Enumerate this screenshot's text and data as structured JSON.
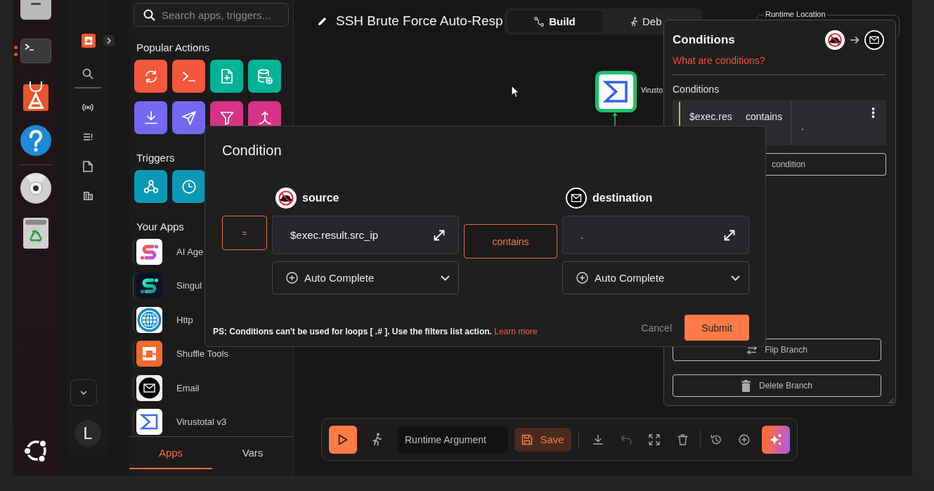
{
  "dock": {
    "apps": [
      {
        "kind": "files",
        "running": false
      },
      {
        "kind": "terminal",
        "running": true
      },
      {
        "kind": "store",
        "running": false
      },
      {
        "kind": "help",
        "running": false
      }
    ],
    "volumes": [
      {
        "kind": "disc"
      },
      {
        "kind": "trash"
      }
    ]
  },
  "nav_rail": {
    "items": [
      {
        "kind": "search",
        "selected": true
      },
      {
        "kind": "signal",
        "selected": false
      },
      {
        "kind": "list",
        "selected": false
      },
      {
        "kind": "file",
        "selected": false
      },
      {
        "kind": "table",
        "selected": false
      }
    ],
    "avatar": "L"
  },
  "sidebar": {
    "search": {
      "placeholder": "Search apps, triggers..."
    },
    "popular_title": "Popular Actions",
    "popular_actions": [
      {
        "kind": "repeat",
        "color": "#f4583c"
      },
      {
        "kind": "terminal",
        "color": "#f4583c"
      },
      {
        "kind": "file_add",
        "color": "#00b296"
      },
      {
        "kind": "database_add",
        "color": "#00b296"
      },
      {
        "kind": "download",
        "color": "#7468f0"
      },
      {
        "kind": "send",
        "color": "#7468f0"
      },
      {
        "kind": "filter",
        "color": "#d63384"
      },
      {
        "kind": "merge",
        "color": "#d63384"
      }
    ],
    "triggers_title": "Triggers",
    "triggers": [
      {
        "kind": "webhook",
        "color": "#0a98b4"
      },
      {
        "kind": "schedule",
        "color": "#0a98b4"
      }
    ],
    "apps_title": "Your Apps",
    "apps": [
      {
        "kind": "ai_agent",
        "name": "AI Age"
      },
      {
        "kind": "singul",
        "name": "Singul"
      },
      {
        "kind": "http",
        "name": "Http"
      },
      {
        "kind": "shuffle_tools",
        "name": "Shuffle Tools"
      },
      {
        "kind": "email",
        "name": "Email"
      },
      {
        "kind": "virustotal",
        "name": "Virustotal v3"
      }
    ],
    "tabs": [
      {
        "label": "Apps",
        "selected": true
      },
      {
        "label": "Vars",
        "selected": false
      }
    ]
  },
  "workflow": {
    "title": "SSH Brute Force Auto-Resp",
    "mode_tabs": [
      {
        "kind": "build",
        "label": "Build",
        "selected": true
      },
      {
        "kind": "debug",
        "label": "Deb",
        "selected": false
      }
    ],
    "runtime_location": {
      "label": "Runtime Location"
    },
    "nodes": [
      {
        "kind": "virustotal",
        "label": "Virusto"
      }
    ]
  },
  "conditions_panel": {
    "title": "Conditions",
    "help_link": "What are conditions?",
    "section_label": "Conditions",
    "conditions": [
      {
        "source": "$exec.res",
        "operator": "contains",
        "destination": "."
      }
    ],
    "new_condition": "condition",
    "actions": [
      {
        "kind": "flip",
        "label": "Flip Branch"
      },
      {
        "kind": "delete",
        "label": "Delete Branch"
      }
    ]
  },
  "condition_dialog": {
    "title": "Condition",
    "negate": "=",
    "source": {
      "label": "source",
      "value": "$exec.result.src_ip",
      "autocomplete": "Auto Complete"
    },
    "operator": "contains",
    "destination": {
      "label": "destination",
      "value": ".",
      "autocomplete": "Auto Complete"
    },
    "note": "PS: Conditions can't be used for loops [ .# ]. Use the filters list action.",
    "note_link": "Learn more",
    "cancel": "Cancel",
    "submit": "Submit"
  },
  "toolbar": {
    "runtime_argument": {
      "placeholder": "Runtime Argument"
    },
    "save": "Save",
    "edit_tools": [
      {
        "kind": "download",
        "disabled": false
      },
      {
        "kind": "undo",
        "disabled": true
      },
      {
        "kind": "fullscreen",
        "disabled": false
      },
      {
        "kind": "delete",
        "disabled": false
      }
    ],
    "view_tools": [
      {
        "kind": "history",
        "disabled": false
      },
      {
        "kind": "add",
        "disabled": false
      }
    ]
  }
}
